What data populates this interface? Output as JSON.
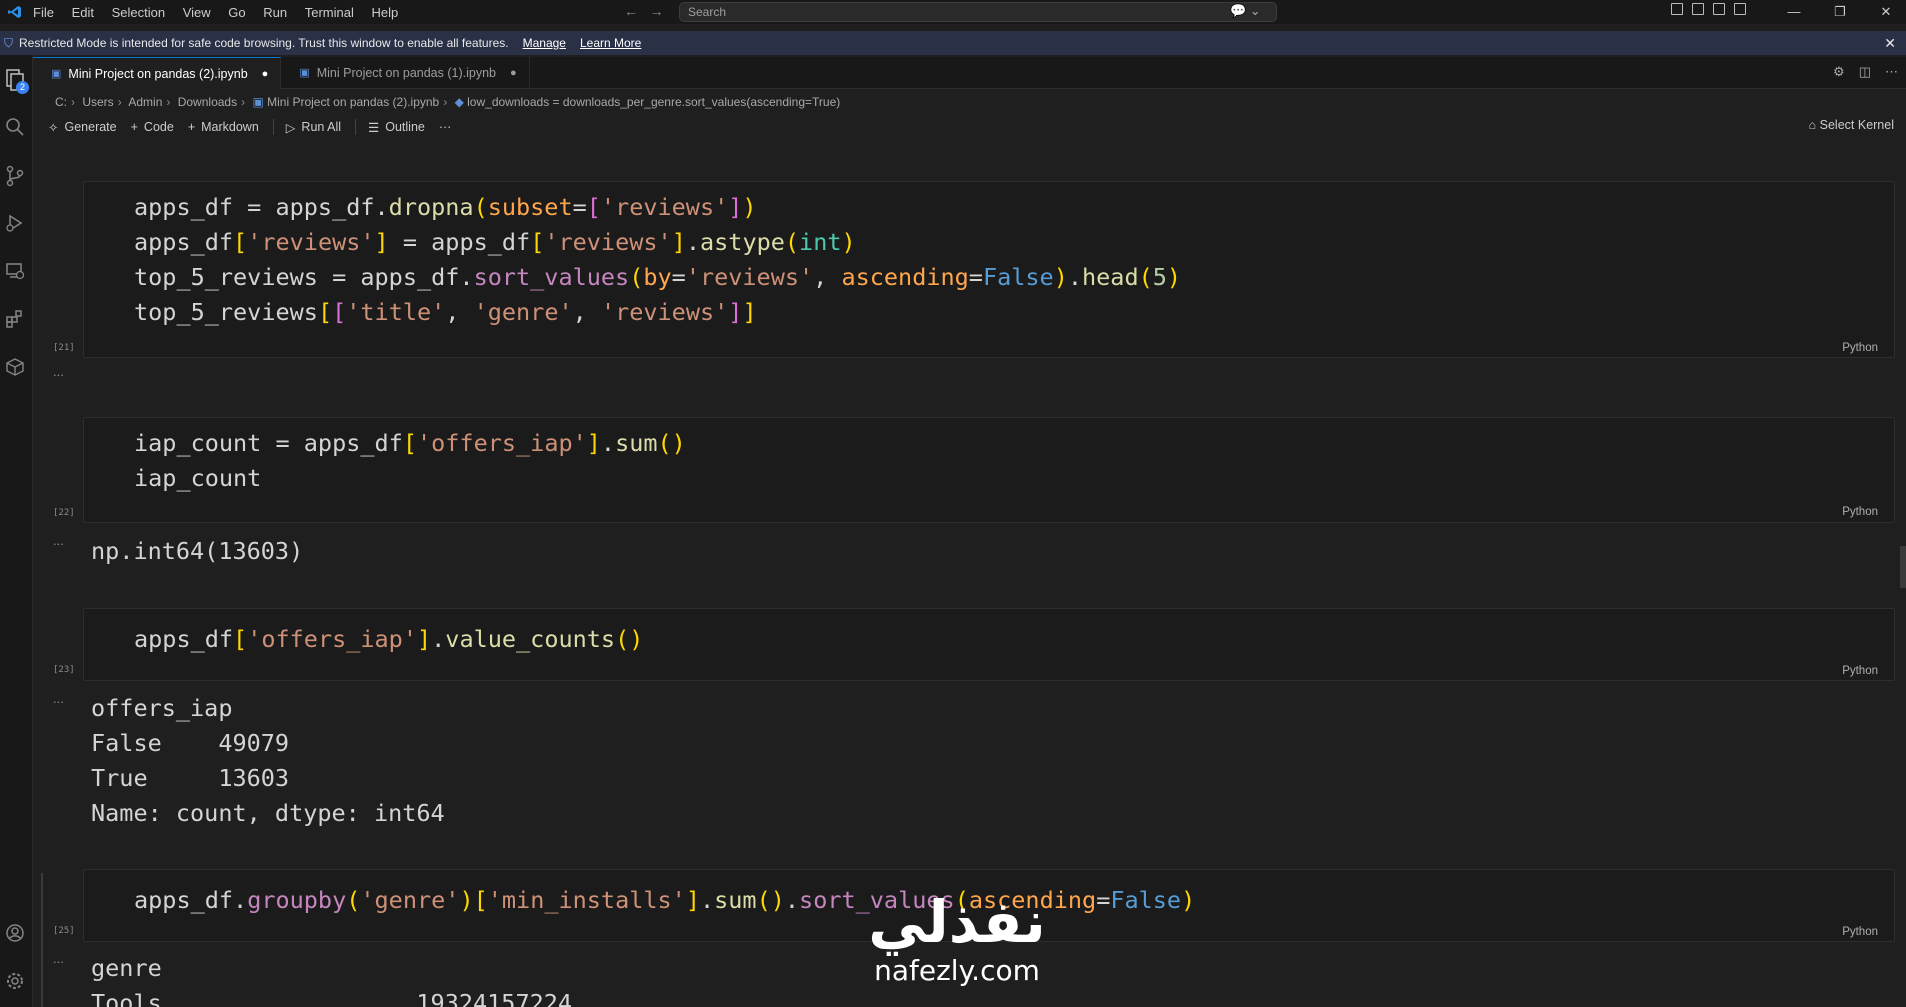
{
  "titlebar": {
    "menu": [
      "File",
      "Edit",
      "Selection",
      "View",
      "Go",
      "Run",
      "Terminal",
      "Help"
    ],
    "search_placeholder": "Search"
  },
  "banner": {
    "message": "Restricted Mode is intended for safe code browsing. Trust this window to enable all features.",
    "manage": "Manage",
    "learn_more": "Learn More"
  },
  "activity": {
    "badge": "2"
  },
  "tabs": [
    {
      "label": "Mini Project on pandas (2).ipynb",
      "active": true
    },
    {
      "label": "Mini Project on pandas (1).ipynb",
      "active": false
    }
  ],
  "breadcrumb": [
    "C:",
    "Users",
    "Admin",
    "Downloads",
    "Mini Project on pandas (2).ipynb",
    "low_downloads = downloads_per_genre.sort_values(ascending=True)"
  ],
  "toolbar": {
    "generate": "Generate",
    "code": "Code",
    "markdown": "Markdown",
    "run_all": "Run All",
    "outline": "Outline",
    "more": "···",
    "select_kernel": "Select Kernel"
  },
  "cells": [
    {
      "exec": "[21]",
      "lang": "Python"
    },
    {
      "exec": "[22]",
      "lang": "Python",
      "output": "np.int64(13603)"
    },
    {
      "exec": "[23]",
      "lang": "Python",
      "output": [
        "offers_iap",
        "False    49079",
        "True     13603",
        "Name: count, dtype: int64"
      ]
    },
    {
      "exec": "[25]",
      "lang": "Python",
      "output": [
        "genre",
        "Tools                  19324157224"
      ]
    }
  ],
  "ellipsis": "...",
  "watermark": {
    "arabic": "نفذلي",
    "latin": "nafezly.com"
  }
}
